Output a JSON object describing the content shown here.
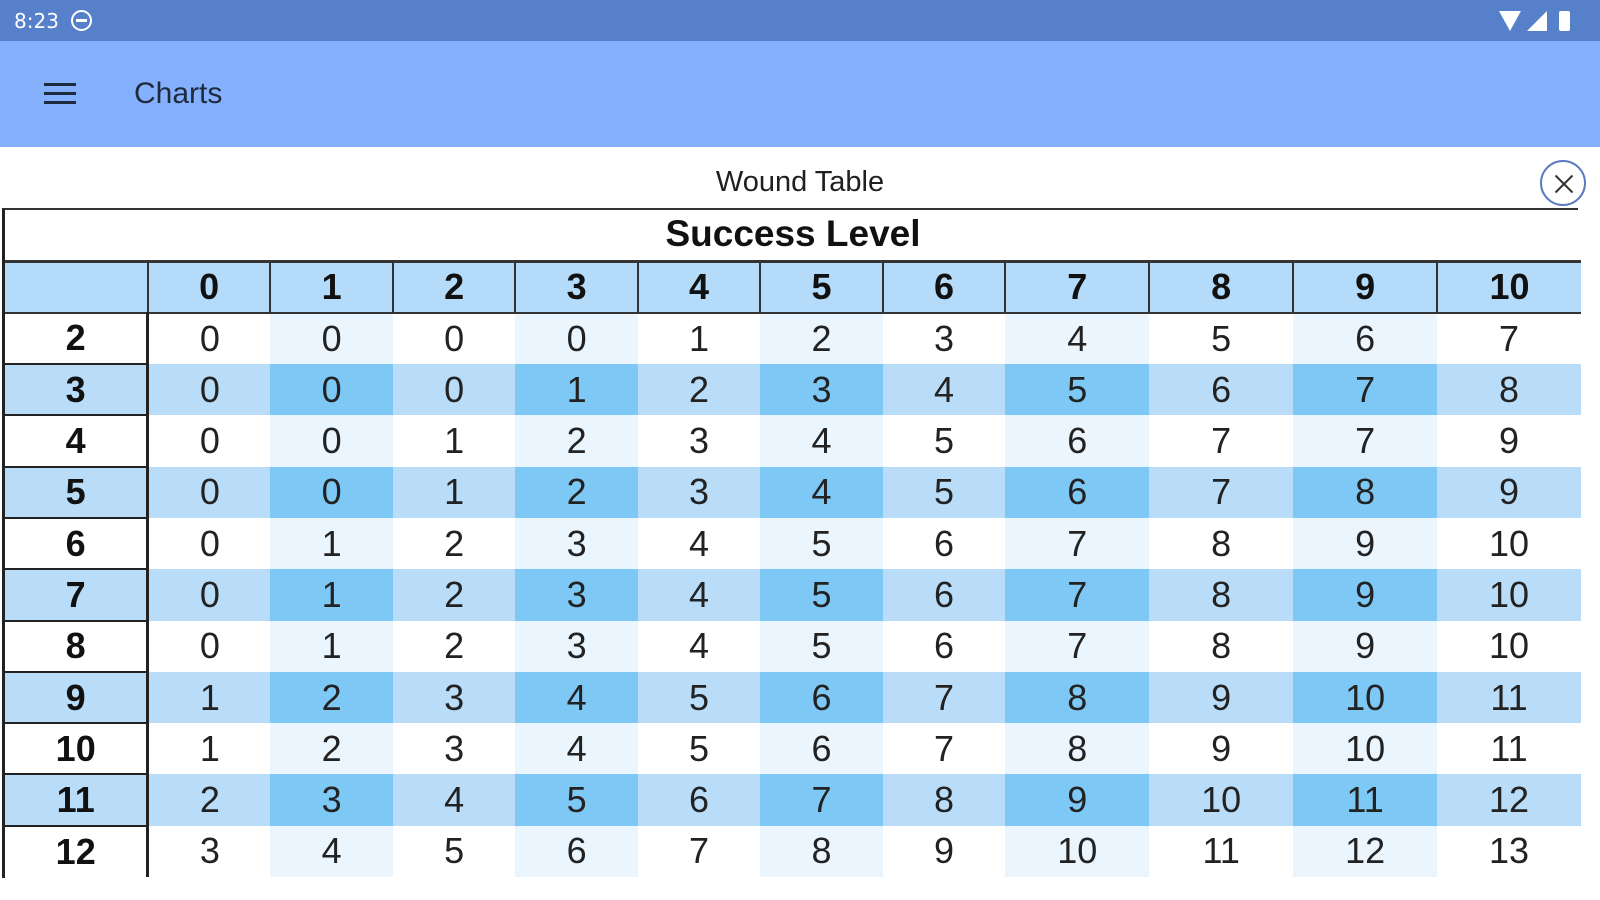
{
  "status_bar": {
    "time": "8:23",
    "icons": [
      "dnd-icon",
      "wifi-icon",
      "signal-icon",
      "battery-icon"
    ]
  },
  "app_bar": {
    "title": "Charts",
    "menu_icon": "hamburger-menu-icon"
  },
  "dialog": {
    "title": "Wound Table",
    "close_icon": "close-icon"
  },
  "table": {
    "caption": "Success Level",
    "column_headers": [
      "0",
      "1",
      "2",
      "3",
      "4",
      "5",
      "6",
      "7",
      "8",
      "9",
      "10"
    ],
    "rows": [
      {
        "label": "2",
        "values": [
          "0",
          "0",
          "0",
          "0",
          "1",
          "2",
          "3",
          "4",
          "5",
          "6",
          "7"
        ]
      },
      {
        "label": "3",
        "values": [
          "0",
          "0",
          "0",
          "1",
          "2",
          "3",
          "4",
          "5",
          "6",
          "7",
          "8"
        ]
      },
      {
        "label": "4",
        "values": [
          "0",
          "0",
          "1",
          "2",
          "3",
          "4",
          "5",
          "6",
          "7",
          "7",
          "9"
        ]
      },
      {
        "label": "5",
        "values": [
          "0",
          "0",
          "1",
          "2",
          "3",
          "4",
          "5",
          "6",
          "7",
          "8",
          "9"
        ]
      },
      {
        "label": "6",
        "values": [
          "0",
          "1",
          "2",
          "3",
          "4",
          "5",
          "6",
          "7",
          "8",
          "9",
          "10"
        ]
      },
      {
        "label": "7",
        "values": [
          "0",
          "1",
          "2",
          "3",
          "4",
          "5",
          "6",
          "7",
          "8",
          "9",
          "10"
        ]
      },
      {
        "label": "8",
        "values": [
          "0",
          "1",
          "2",
          "3",
          "4",
          "5",
          "6",
          "7",
          "8",
          "9",
          "10"
        ]
      },
      {
        "label": "9",
        "values": [
          "1",
          "2",
          "3",
          "4",
          "5",
          "6",
          "7",
          "8",
          "9",
          "10",
          "11"
        ]
      },
      {
        "label": "10",
        "values": [
          "1",
          "2",
          "3",
          "4",
          "5",
          "6",
          "7",
          "8",
          "9",
          "10",
          "11"
        ]
      },
      {
        "label": "11",
        "values": [
          "2",
          "3",
          "4",
          "5",
          "6",
          "7",
          "8",
          "9",
          "10",
          "11",
          "12"
        ]
      },
      {
        "label": "12",
        "values": [
          "3",
          "4",
          "5",
          "6",
          "7",
          "8",
          "9",
          "10",
          "11",
          "12",
          "13"
        ]
      }
    ]
  },
  "colors": {
    "status_bar": "#5680c9",
    "app_bar": "#84b0fd",
    "header_row": "#b4dcfa",
    "cell_light": "#eaf5fd",
    "cell_medium": "#b9ddf9",
    "cell_dark": "#7ec8f6"
  }
}
